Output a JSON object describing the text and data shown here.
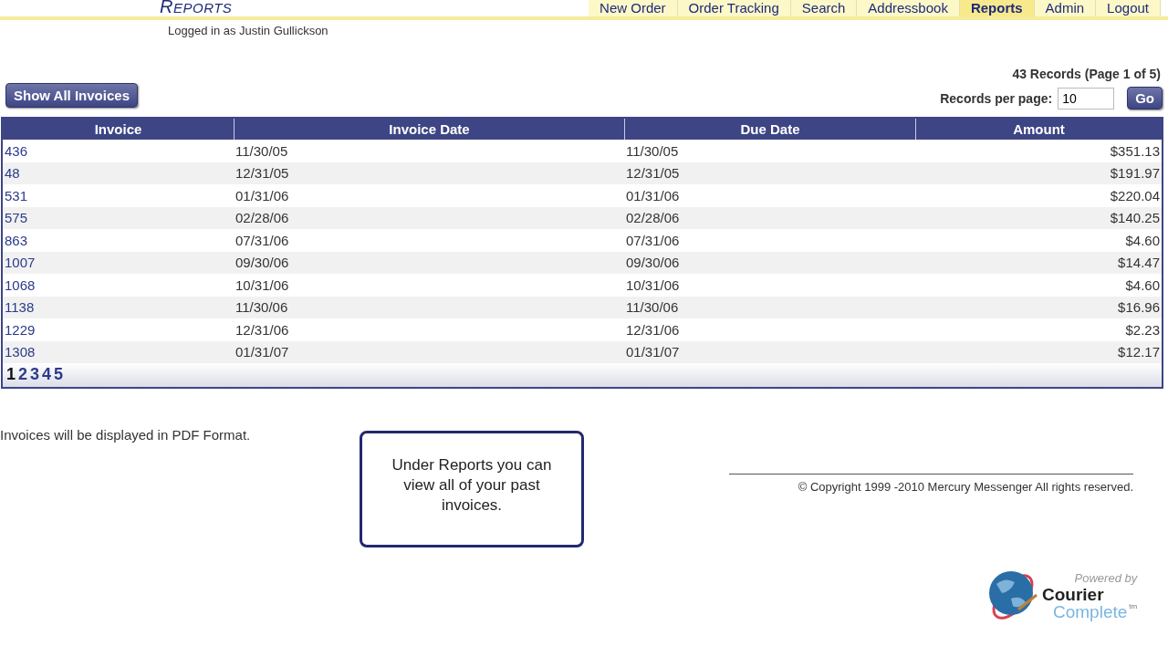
{
  "header": {
    "title": "REPORTS",
    "logged_in": "Logged in as Justin Gullickson"
  },
  "nav": [
    {
      "label": "New Order",
      "selected": false
    },
    {
      "label": "Order Tracking",
      "selected": false
    },
    {
      "label": "Search",
      "selected": false
    },
    {
      "label": "Addressbook",
      "selected": false
    },
    {
      "label": "Reports",
      "selected": true
    },
    {
      "label": "Admin",
      "selected": false
    },
    {
      "label": "Logout",
      "selected": false
    }
  ],
  "show_all_button": "Show All Invoices",
  "records_summary": "43 Records (Page 1 of 5)",
  "per_page": {
    "label": "Records per page:",
    "value": "10",
    "button": "Go"
  },
  "table": {
    "columns": [
      "Invoice",
      "Invoice Date",
      "Due Date",
      "Amount"
    ],
    "rows": [
      [
        "436",
        "11/30/05",
        "11/30/05",
        "$351.13"
      ],
      [
        "48",
        "12/31/05",
        "12/31/05",
        "$191.97"
      ],
      [
        "531",
        "01/31/06",
        "01/31/06",
        "$220.04"
      ],
      [
        "575",
        "02/28/06",
        "02/28/06",
        "$140.25"
      ],
      [
        "863",
        "07/31/06",
        "07/31/06",
        "$4.60"
      ],
      [
        "1007",
        "09/30/06",
        "09/30/06",
        "$14.47"
      ],
      [
        "1068",
        "10/31/06",
        "10/31/06",
        "$4.60"
      ],
      [
        "1138",
        "11/30/06",
        "11/30/06",
        "$16.96"
      ],
      [
        "1229",
        "12/31/06",
        "12/31/06",
        "$2.23"
      ],
      [
        "1308",
        "01/31/07",
        "01/31/07",
        "$12.17"
      ]
    ],
    "pages": [
      {
        "label": "1",
        "selected": true
      },
      {
        "label": "2",
        "selected": false
      },
      {
        "label": "3",
        "selected": false
      },
      {
        "label": "4",
        "selected": false
      },
      {
        "label": "5",
        "selected": false
      }
    ]
  },
  "note": "Invoices will be displayed in PDF Format.",
  "callout": "Under Reports you can view all of your past invoices.",
  "copyright": "© Copyright 1999 -2010 Mercury Messenger All rights reserved.",
  "logo": {
    "powered_by": "Powered by",
    "line1": "Courier",
    "line2": "Complete",
    "tm": "tm"
  }
}
